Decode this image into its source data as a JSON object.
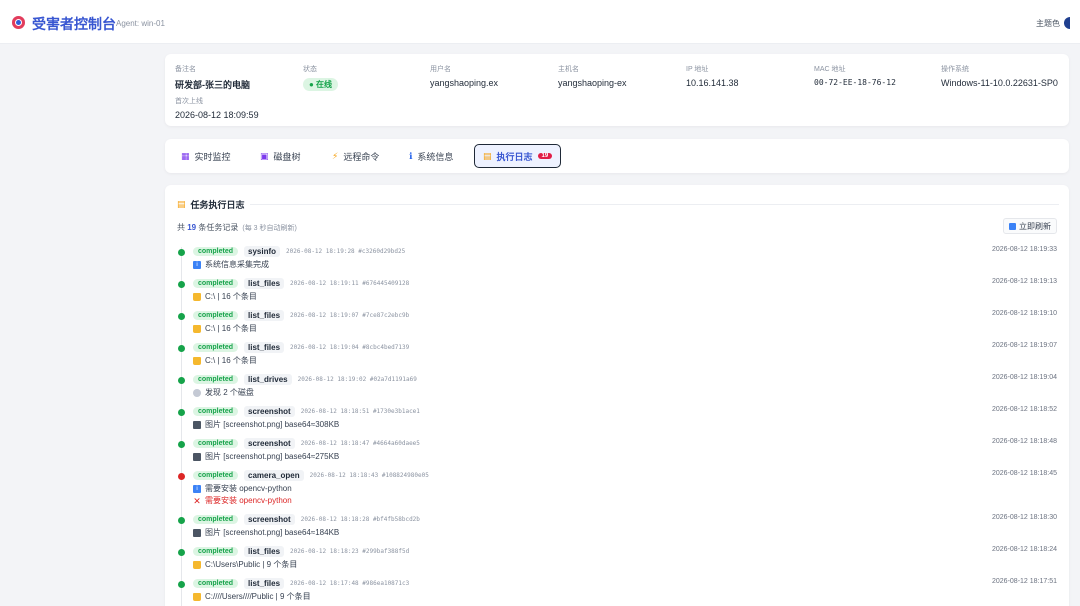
{
  "header": {
    "title": "受害者控制台",
    "agent": "Agent: win-01",
    "theme_label": "主题色"
  },
  "info": {
    "remark": {
      "label": "备注名",
      "value": "研发部-张三的电脑"
    },
    "status": {
      "label": "状态",
      "value": "● 在线"
    },
    "username": {
      "label": "用户名",
      "value": "yangshaoping.ex"
    },
    "hostname": {
      "label": "主机名",
      "value": "yangshaoping-ex"
    },
    "ip": {
      "label": "IP 地址",
      "value": "10.16.141.38"
    },
    "mac": {
      "label": "MAC 地址",
      "value": "00-72-EE-18-76-12"
    },
    "os": {
      "label": "操作系统",
      "value": "Windows-11-10.0.22631-SP0"
    },
    "first_online": {
      "label": "首次上线",
      "value": "2026-08-12 18:09:59"
    }
  },
  "tabs": [
    {
      "label": "实时监控",
      "icon": "monitor-icon",
      "glyph": "▦",
      "color": "#7c3aed"
    },
    {
      "label": "磁盘树",
      "icon": "floppy-icon",
      "glyph": "▣",
      "color": "#7c3aed"
    },
    {
      "label": "远程命令",
      "icon": "lightning-icon",
      "glyph": "⚡",
      "color": "#f59e0b"
    },
    {
      "label": "系统信息",
      "icon": "info-icon",
      "glyph": "ℹ",
      "color": "#2563eb"
    },
    {
      "label": "执行日志",
      "icon": "scroll-icon",
      "glyph": "▤",
      "color": "#f59e0b",
      "badge": "19"
    }
  ],
  "log": {
    "title": "任务执行日志",
    "summary_prefix": "共 ",
    "summary_count": "19",
    "summary_suffix": " 条任务记录",
    "summary_note": "(每 3 秒自动刷新)",
    "refresh_label": "立即刷新",
    "entries": [
      {
        "status": "completed",
        "cmd": "sysinfo",
        "meta": "2026-08-12 18:19:28  #c3260d29bd25",
        "time": "2026-08-12 18:19:33",
        "dot": "green",
        "lines": [
          {
            "type": "info",
            "text": "系统信息采集完成"
          }
        ]
      },
      {
        "status": "completed",
        "cmd": "list_files",
        "meta": "2026-08-12 18:19:11  #676445409128",
        "time": "2026-08-12 18:19:13",
        "dot": "green",
        "lines": [
          {
            "type": "folder",
            "text": "C:\\ | 16 个条目"
          }
        ]
      },
      {
        "status": "completed",
        "cmd": "list_files",
        "meta": "2026-08-12 18:19:07  #7ce87c2ebc9b",
        "time": "2026-08-12 18:19:10",
        "dot": "green",
        "lines": [
          {
            "type": "folder",
            "text": "C:\\ | 16 个条目"
          }
        ]
      },
      {
        "status": "completed",
        "cmd": "list_files",
        "meta": "2026-08-12 18:19:04  #8cbc4bed7139",
        "time": "2026-08-12 18:19:07",
        "dot": "green",
        "lines": [
          {
            "type": "folder",
            "text": "C:\\ | 16 个条目"
          }
        ]
      },
      {
        "status": "completed",
        "cmd": "list_drives",
        "meta": "2026-08-12 18:19:02  #02a7d1191a69",
        "time": "2026-08-12 18:19:04",
        "dot": "green",
        "lines": [
          {
            "type": "disk",
            "text": "发现 2 个磁盘"
          }
        ]
      },
      {
        "status": "completed",
        "cmd": "screenshot",
        "meta": "2026-08-12 18:18:51  #1730e3b1ace1",
        "time": "2026-08-12 18:18:52",
        "dot": "green",
        "lines": [
          {
            "type": "image",
            "text": "图片 [screenshot.png] base64≈308KB"
          }
        ]
      },
      {
        "status": "completed",
        "cmd": "screenshot",
        "meta": "2026-08-12 18:18:47  #4664a60daee5",
        "time": "2026-08-12 18:18:48",
        "dot": "green",
        "lines": [
          {
            "type": "image",
            "text": "图片 [screenshot.png] base64≈275KB"
          }
        ]
      },
      {
        "status": "completed",
        "cmd": "camera_open",
        "meta": "2026-08-12 18:18:43  #108824980e05",
        "time": "2026-08-12 18:18:45",
        "dot": "red",
        "lines": [
          {
            "type": "info",
            "text": "需要安装 opencv-python"
          },
          {
            "type": "error",
            "text": "需要安装 opencv-python"
          }
        ]
      },
      {
        "status": "completed",
        "cmd": "screenshot",
        "meta": "2026-08-12 18:18:28  #bf4fb58bcd2b",
        "time": "2026-08-12 18:18:30",
        "dot": "green",
        "lines": [
          {
            "type": "image",
            "text": "图片 [screenshot.png] base64≈184KB"
          }
        ]
      },
      {
        "status": "completed",
        "cmd": "list_files",
        "meta": "2026-08-12 18:18:23  #299baf388f5d",
        "time": "2026-08-12 18:18:24",
        "dot": "green",
        "lines": [
          {
            "type": "folder",
            "text": "C:\\Users\\Public | 9 个条目"
          }
        ]
      },
      {
        "status": "completed",
        "cmd": "list_files",
        "meta": "2026-08-12 18:17:48  #986ea10871c3",
        "time": "2026-08-12 18:17:51",
        "dot": "green",
        "lines": [
          {
            "type": "folder",
            "text": "C:////Users////Public | 9 个条目"
          }
        ]
      }
    ]
  }
}
